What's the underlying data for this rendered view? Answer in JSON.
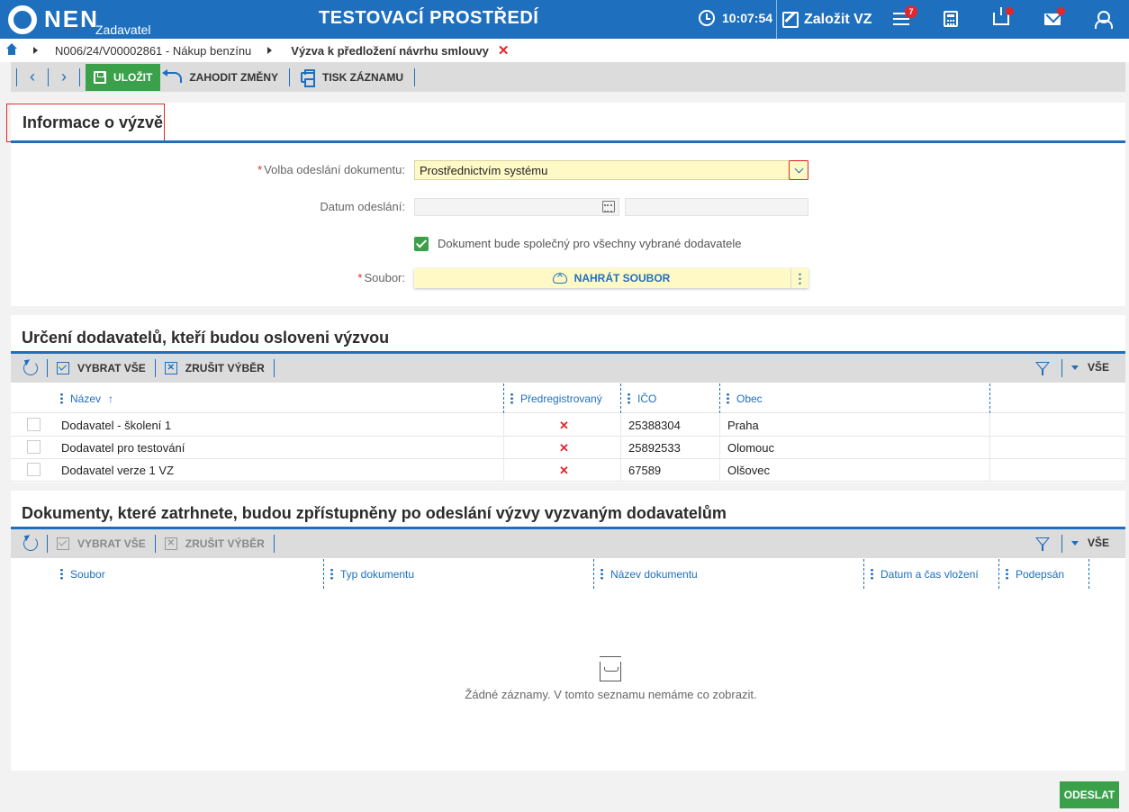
{
  "app": {
    "logo_text": "NEN",
    "logo_subtitle": "Zadavatel",
    "environment_title": "TESTOVACÍ PROSTŘEDÍ",
    "clock_time": "10:07:54",
    "create_label": "Založit VZ",
    "menu_badge": "7"
  },
  "breadcrumb": {
    "items": [
      "N006/24/V00002861 - Nákup benzínu",
      "Výzva k předložení návrhu smlouvy"
    ]
  },
  "toolbar": {
    "save_label": "ULOŽIT",
    "discard_label": "ZAHODIT ZMĚNY",
    "print_label": "TISK ZÁZNAMU"
  },
  "info_section": {
    "title": "Informace o výzvě",
    "send_option_label": "Volba odeslání dokumentu:",
    "send_option_value": "Prostřednictvím systému",
    "send_date_label": "Datum odeslání:",
    "shared_doc_label": "Dokument bude společný pro všechny vybrané dodavatele",
    "shared_doc_checked": true,
    "file_label": "Soubor:",
    "upload_label": "NAHRÁT SOUBOR",
    "required_mark": "*"
  },
  "suppliers_section": {
    "title": "Určení dodavatelů, kteří budou osloveni výzvou",
    "select_all_label": "VYBRAT VŠE",
    "clear_selection_label": "ZRUŠIT VÝBĚR",
    "view_label": "VŠE",
    "columns": [
      "Název",
      "Předregistrovaný",
      "IČO",
      "Obec"
    ],
    "rows": [
      {
        "name": "Dodavatel - školení 1",
        "preregistered": "✕",
        "ico": "25388304",
        "city": "Praha"
      },
      {
        "name": "Dodavatel pro testování",
        "preregistered": "✕",
        "ico": "25892533",
        "city": "Olomouc"
      },
      {
        "name": "Dodavatel verze 1 VZ",
        "preregistered": "✕",
        "ico": "67589",
        "city": "Olšovec"
      }
    ]
  },
  "documents_section": {
    "title": "Dokumenty, které zatrhnete, budou zpřístupněny po odeslání výzvy vyzvaným dodavatelům",
    "select_all_label": "VYBRAT VŠE",
    "clear_selection_label": "ZRUŠIT VÝBĚR",
    "view_label": "VŠE",
    "columns": [
      "Soubor",
      "Typ dokumentu",
      "Název dokumentu",
      "Datum a čas vložení",
      "Podepsán"
    ],
    "empty_text": "Žádné záznamy. V tomto seznamu nemáme co zobrazit."
  },
  "footer": {
    "send_label": "ODESLAT"
  },
  "colors": {
    "brand_blue": "#1f6fbf",
    "success_green": "#3aa14a",
    "danger_red": "#e4262c",
    "required_yellow": "#fff9c6"
  }
}
